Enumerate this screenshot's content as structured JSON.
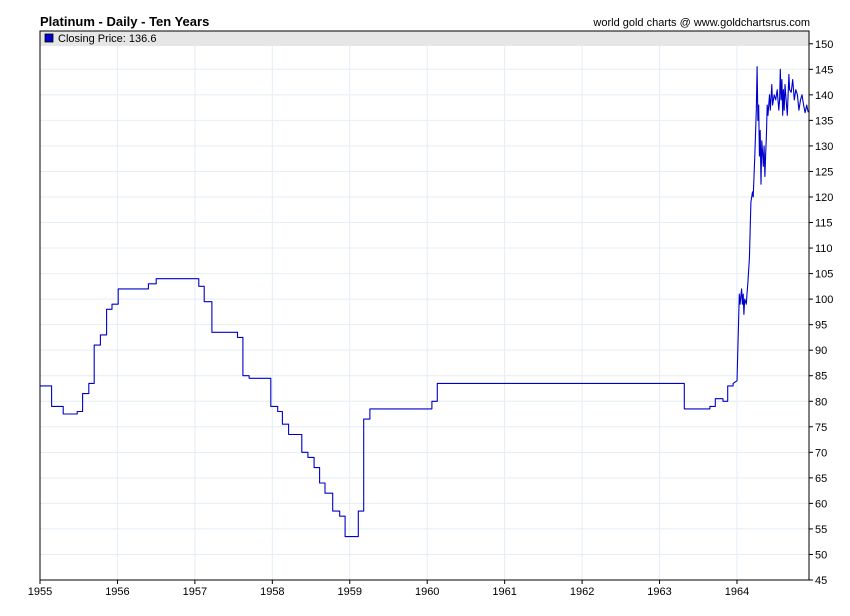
{
  "chart_data": {
    "type": "line",
    "title": "Platinum - Daily - Ten Years",
    "source": "world gold charts @ www.goldchartsrus.com",
    "legend": {
      "label": "Closing Price: 136.6",
      "placement": "top-left",
      "color": "#0000cc"
    },
    "xlabel": "",
    "ylabel": "",
    "x_ticks": [
      "1955",
      "1956",
      "1957",
      "1958",
      "1959",
      "1960",
      "1961",
      "1962",
      "1963",
      "1964"
    ],
    "xlim": [
      1955.0,
      1964.93
    ],
    "y_ticks": [
      45,
      50,
      55,
      60,
      65,
      70,
      75,
      80,
      85,
      90,
      95,
      100,
      105,
      110,
      115,
      120,
      125,
      130,
      135,
      140,
      145,
      150
    ],
    "ylim": [
      45,
      152.5
    ],
    "grid": true,
    "series": [
      {
        "name": "Closing Price",
        "color": "#0000cc",
        "points": [
          [
            1955.0,
            83
          ],
          [
            1955.15,
            83
          ],
          [
            1955.15,
            79
          ],
          [
            1955.3,
            79
          ],
          [
            1955.3,
            77.5
          ],
          [
            1955.48,
            77.5
          ],
          [
            1955.48,
            78
          ],
          [
            1955.55,
            78
          ],
          [
            1955.55,
            81.5
          ],
          [
            1955.63,
            81.5
          ],
          [
            1955.63,
            83.5
          ],
          [
            1955.7,
            83.5
          ],
          [
            1955.7,
            91
          ],
          [
            1955.78,
            91
          ],
          [
            1955.78,
            93
          ],
          [
            1955.86,
            93
          ],
          [
            1955.86,
            98
          ],
          [
            1955.93,
            98
          ],
          [
            1955.93,
            99
          ],
          [
            1956.01,
            99
          ],
          [
            1956.01,
            102
          ],
          [
            1956.4,
            102
          ],
          [
            1956.4,
            103
          ],
          [
            1956.5,
            103
          ],
          [
            1956.5,
            104
          ],
          [
            1957.05,
            104
          ],
          [
            1957.05,
            102.5
          ],
          [
            1957.12,
            102.5
          ],
          [
            1957.12,
            99.5
          ],
          [
            1957.22,
            99.5
          ],
          [
            1957.22,
            93.5
          ],
          [
            1957.55,
            93.5
          ],
          [
            1957.55,
            92.5
          ],
          [
            1957.62,
            92.5
          ],
          [
            1957.62,
            85
          ],
          [
            1957.7,
            85
          ],
          [
            1957.7,
            84.5
          ],
          [
            1957.98,
            84.5
          ],
          [
            1957.98,
            79
          ],
          [
            1958.07,
            79
          ],
          [
            1958.07,
            78
          ],
          [
            1958.13,
            78
          ],
          [
            1958.13,
            75.5
          ],
          [
            1958.21,
            75.5
          ],
          [
            1958.21,
            73.5
          ],
          [
            1958.38,
            73.5
          ],
          [
            1958.38,
            70
          ],
          [
            1958.46,
            70
          ],
          [
            1958.46,
            69
          ],
          [
            1958.54,
            69
          ],
          [
            1958.54,
            67
          ],
          [
            1958.61,
            67
          ],
          [
            1958.61,
            64
          ],
          [
            1958.68,
            64
          ],
          [
            1958.68,
            62
          ],
          [
            1958.78,
            62
          ],
          [
            1958.78,
            58.5
          ],
          [
            1958.87,
            58.5
          ],
          [
            1958.87,
            57.5
          ],
          [
            1958.94,
            57.5
          ],
          [
            1958.94,
            53.5
          ],
          [
            1959.11,
            53.5
          ],
          [
            1959.11,
            58.5
          ],
          [
            1959.18,
            58.5
          ],
          [
            1959.18,
            76.5
          ],
          [
            1959.26,
            76.5
          ],
          [
            1959.26,
            78.5
          ],
          [
            1960.06,
            78.5
          ],
          [
            1960.06,
            80
          ],
          [
            1960.13,
            80
          ],
          [
            1960.13,
            83.5
          ],
          [
            1963.32,
            83.5
          ],
          [
            1963.32,
            78.5
          ],
          [
            1963.65,
            78.5
          ],
          [
            1963.65,
            79
          ],
          [
            1963.72,
            79
          ],
          [
            1963.72,
            80.5
          ],
          [
            1963.82,
            80.5
          ],
          [
            1963.82,
            80
          ],
          [
            1963.88,
            80
          ],
          [
            1963.88,
            83
          ],
          [
            1963.95,
            83
          ],
          [
            1963.95,
            83.5
          ],
          [
            1964.0,
            84
          ],
          [
            1964.02,
            95
          ],
          [
            1964.03,
            101
          ],
          [
            1964.04,
            99
          ],
          [
            1964.06,
            102
          ],
          [
            1964.07,
            99
          ],
          [
            1964.08,
            101
          ],
          [
            1964.09,
            97
          ],
          [
            1964.1,
            100
          ],
          [
            1964.12,
            99
          ],
          [
            1964.13,
            101
          ],
          [
            1964.14,
            103
          ],
          [
            1964.16,
            108
          ],
          [
            1964.18,
            119
          ],
          [
            1964.2,
            121
          ],
          [
            1964.21,
            120
          ],
          [
            1964.23,
            128
          ],
          [
            1964.25,
            137
          ],
          [
            1964.26,
            145.5
          ],
          [
            1964.27,
            135
          ],
          [
            1964.28,
            138
          ],
          [
            1964.29,
            128
          ],
          [
            1964.3,
            133
          ],
          [
            1964.31,
            122.5
          ],
          [
            1964.32,
            131
          ],
          [
            1964.33,
            129
          ],
          [
            1964.34,
            126
          ],
          [
            1964.35,
            130
          ],
          [
            1964.36,
            124
          ],
          [
            1964.37,
            128
          ],
          [
            1964.38,
            132
          ],
          [
            1964.39,
            138
          ],
          [
            1964.4,
            136
          ],
          [
            1964.42,
            140
          ],
          [
            1964.43,
            137
          ],
          [
            1964.45,
            142
          ],
          [
            1964.46,
            138
          ],
          [
            1964.48,
            140
          ],
          [
            1964.5,
            139
          ],
          [
            1964.52,
            141
          ],
          [
            1964.54,
            137
          ],
          [
            1964.55,
            139
          ],
          [
            1964.56,
            145
          ],
          [
            1964.57,
            139
          ],
          [
            1964.58,
            143
          ],
          [
            1964.59,
            136
          ],
          [
            1964.6,
            141
          ],
          [
            1964.61,
            137
          ],
          [
            1964.62,
            142
          ],
          [
            1964.64,
            138
          ],
          [
            1964.65,
            136
          ],
          [
            1964.67,
            144
          ],
          [
            1964.68,
            141
          ],
          [
            1964.7,
            140.5
          ],
          [
            1964.72,
            143
          ],
          [
            1964.74,
            139
          ],
          [
            1964.76,
            141
          ],
          [
            1964.78,
            140
          ],
          [
            1964.8,
            137
          ],
          [
            1964.82,
            139
          ],
          [
            1964.84,
            140
          ],
          [
            1964.86,
            138
          ],
          [
            1964.88,
            136.5
          ],
          [
            1964.9,
            138
          ],
          [
            1964.92,
            136.6
          ]
        ]
      }
    ]
  }
}
